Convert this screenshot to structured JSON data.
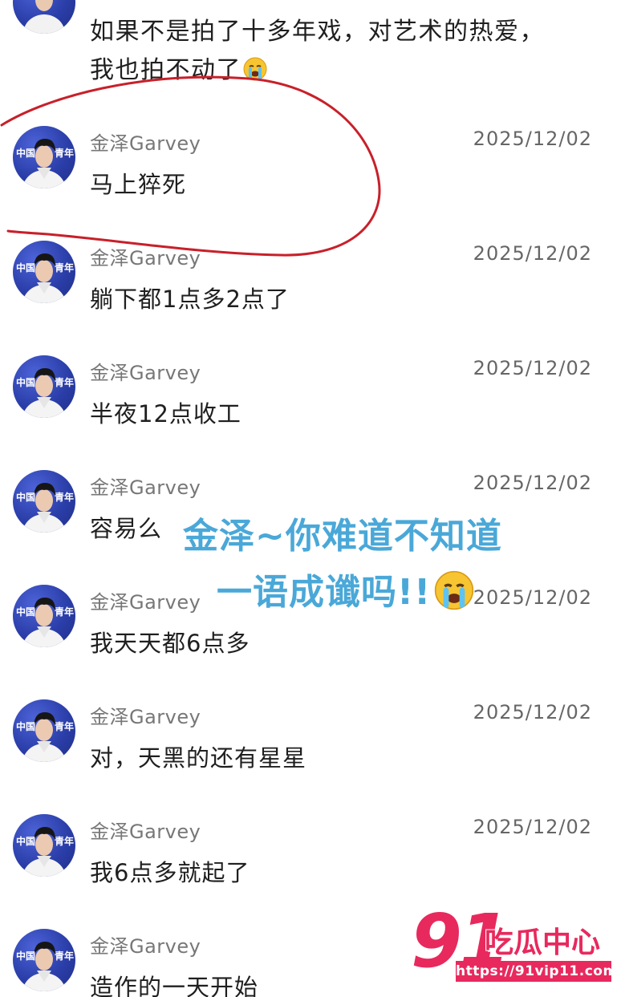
{
  "top_message": {
    "line1": "如果不是拍了十多年戏，对艺术的热爱，",
    "line2": "我也拍不动了",
    "emoji": "loudly-crying-face-icon"
  },
  "avatar_badge": {
    "left": "中国",
    "right": "青年"
  },
  "messages": [
    {
      "username": "金泽Garvey",
      "date": "2025/12/02",
      "text": "马上猝死"
    },
    {
      "username": "金泽Garvey",
      "date": "2025/12/02",
      "text": "躺下都1点多2点了"
    },
    {
      "username": "金泽Garvey",
      "date": "2025/12/02",
      "text": "半夜12点收工"
    },
    {
      "username": "金泽Garvey",
      "date": "2025/12/02",
      "text": "容易么"
    },
    {
      "username": "金泽Garvey",
      "date": "2025/12/02",
      "text": "我天天都6点多"
    },
    {
      "username": "金泽Garvey",
      "date": "2025/12/02",
      "text": "对，天黑的还有星星"
    },
    {
      "username": "金泽Garvey",
      "date": "2025/12/02",
      "text": "我6点多就起了"
    },
    {
      "username": "金泽Garvey",
      "date": "",
      "text": "造作的一天开始"
    }
  ],
  "overlay_caption": {
    "line1": "金泽~你难道不知道",
    "line2": "一语成谶吗!!",
    "emoji": "loudly-crying-face-icon"
  },
  "annotation": {
    "color": "#c8202a"
  },
  "watermark": {
    "number": "91",
    "name": "吃瓜中心",
    "url": "https://91vip11.com",
    "color": "#e8295d"
  },
  "colors": {
    "caption": "#4aa8d8",
    "username": "#777777",
    "avatar_bg": "#2b3ea9"
  }
}
